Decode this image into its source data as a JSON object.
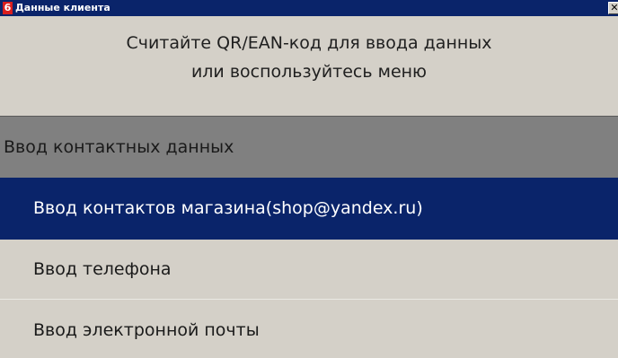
{
  "window": {
    "badge": "6",
    "title": "Данные клиента",
    "close_glyph": "✕"
  },
  "prompt": {
    "line1": "Считайте QR/EAN-код для ввода данных",
    "line2": "или воспользуйтесь меню"
  },
  "menu": {
    "header": "Ввод контактных данных",
    "items": [
      {
        "label": "Ввод контактов магазина(shop@yandex.ru)",
        "selected": true
      },
      {
        "label": "Ввод телефона",
        "selected": false
      },
      {
        "label": "Ввод электронной почты",
        "selected": false
      }
    ]
  },
  "colors": {
    "title_bar": "#0a246a",
    "badge": "#d81e1e",
    "window_bg": "#d4d0c8",
    "header_bg": "#808080",
    "selected_bg": "#0a246a"
  }
}
